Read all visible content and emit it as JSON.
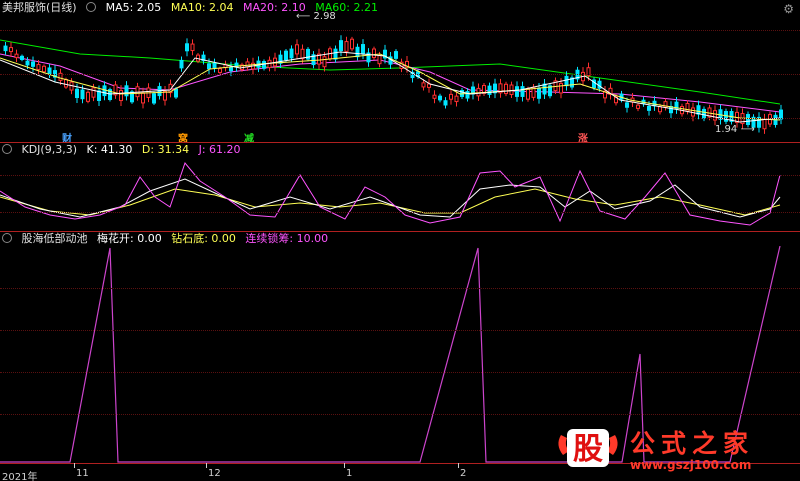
{
  "main_panel": {
    "stock_name": "美邦服饰(日线)",
    "ma5": "MA5: 2.05",
    "ma10": "MA10: 2.04",
    "ma20": "MA20: 2.10",
    "ma60": "MA60: 2.21",
    "high_label": "2.98",
    "low_label": "1.94",
    "tags": [
      "财",
      "窝",
      "减",
      "涨"
    ]
  },
  "kdj_panel": {
    "name": "KDJ(9,3,3)",
    "k": "K: 41.30",
    "d": "D: 31.34",
    "j": "J: 61.20"
  },
  "indicator_panel": {
    "name": "股海低部动池",
    "v1": "梅花开: 0.00",
    "v2": "钻石底: 0.00",
    "v3": "连续锁筹: 10.00"
  },
  "time_axis": [
    "2021年",
    "11",
    "12",
    "1",
    "2"
  ],
  "watermark": {
    "logo_char": "股",
    "text": "公式之家",
    "url": "www.gszj100.com"
  },
  "colors": {
    "up": "#ff3030",
    "down": "#00e5ff",
    "ma5": "#ffffff",
    "ma10": "#ffff55",
    "ma20": "#ff55ff",
    "ma60": "#00ee00",
    "separator": "#b02020",
    "indicator": "#cc44cc"
  }
}
